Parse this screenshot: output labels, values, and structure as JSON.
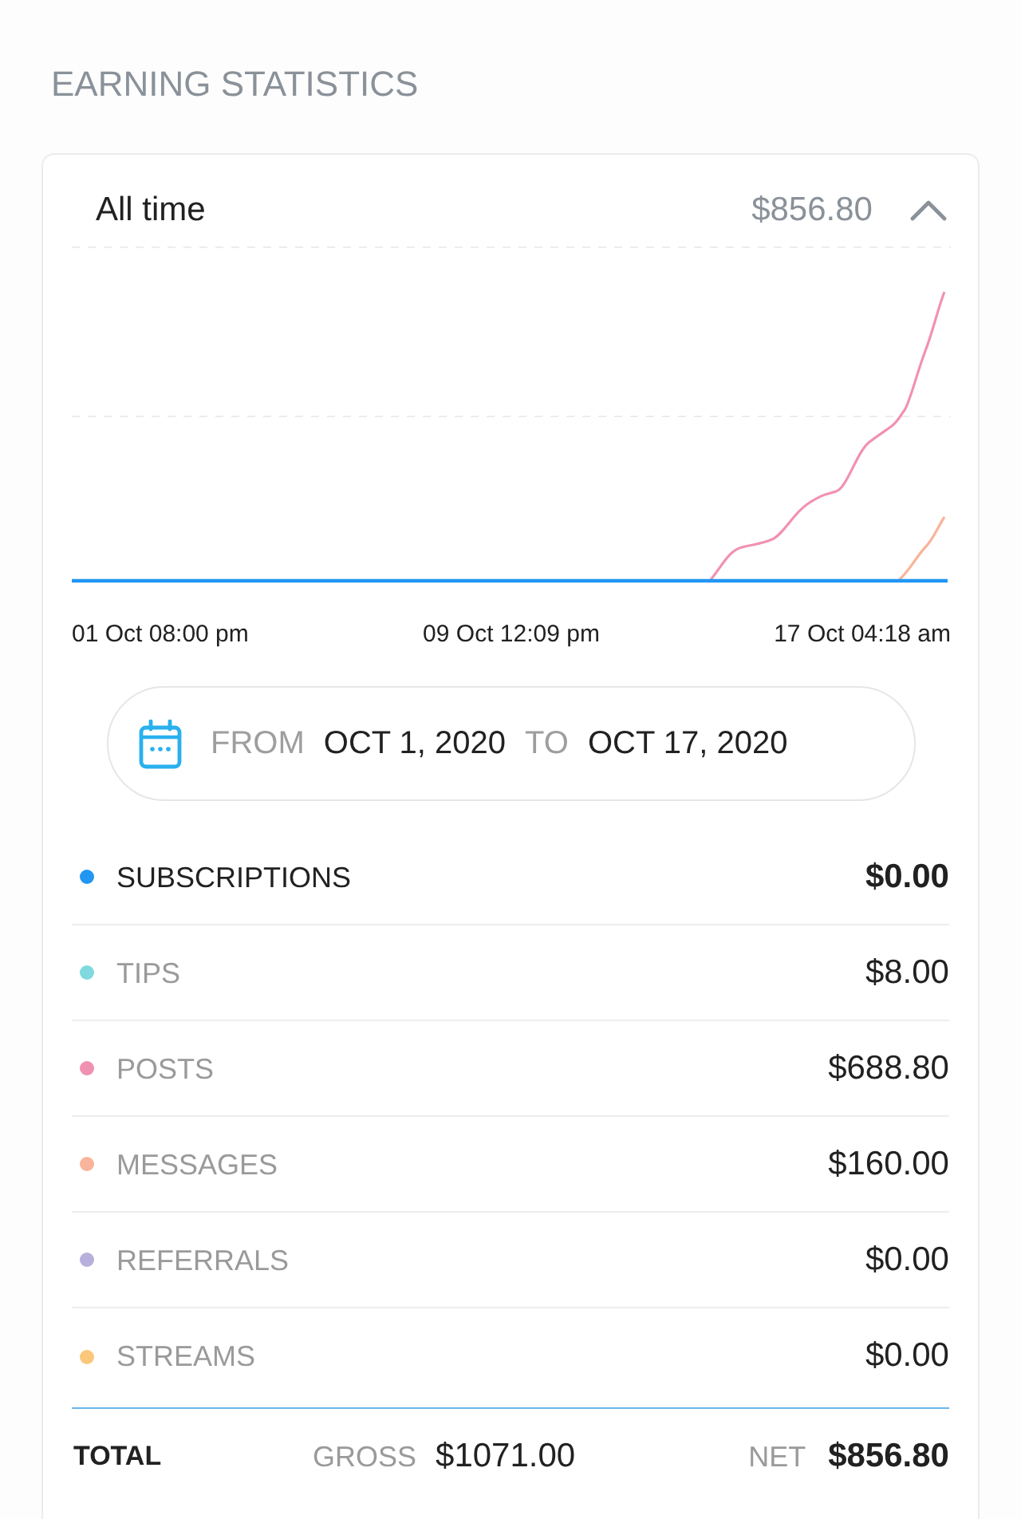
{
  "section_title": "EARNING STATISTICS",
  "card": {
    "period": "All time",
    "total": "$856.80",
    "expanded": true
  },
  "chart": {
    "x_labels": [
      "01 Oct 08:00 pm",
      "09 Oct 12:09 pm",
      "17 Oct 04:18 am"
    ]
  },
  "date_range": {
    "from_label": "FROM",
    "from": "OCT 1, 2020",
    "to_label": "TO",
    "to": "OCT 17, 2020"
  },
  "categories": [
    {
      "label": "SUBSCRIPTIONS",
      "amount": "$0.00",
      "color": "#2196f3",
      "selected": true
    },
    {
      "label": "TIPS",
      "amount": "$8.00",
      "color": "#7fd9de",
      "selected": false
    },
    {
      "label": "POSTS",
      "amount": "$688.80",
      "color": "#f191b1",
      "selected": false
    },
    {
      "label": "MESSAGES",
      "amount": "$160.00",
      "color": "#f9b49b",
      "selected": false
    },
    {
      "label": "REFERRALS",
      "amount": "$0.00",
      "color": "#b7b0dc",
      "selected": false
    },
    {
      "label": "STREAMS",
      "amount": "$0.00",
      "color": "#fbc77b",
      "selected": false
    }
  ],
  "totals": {
    "label": "TOTAL",
    "gross_label": "GROSS",
    "gross": "$1071.00",
    "net_label": "NET",
    "net": "$856.80"
  }
}
